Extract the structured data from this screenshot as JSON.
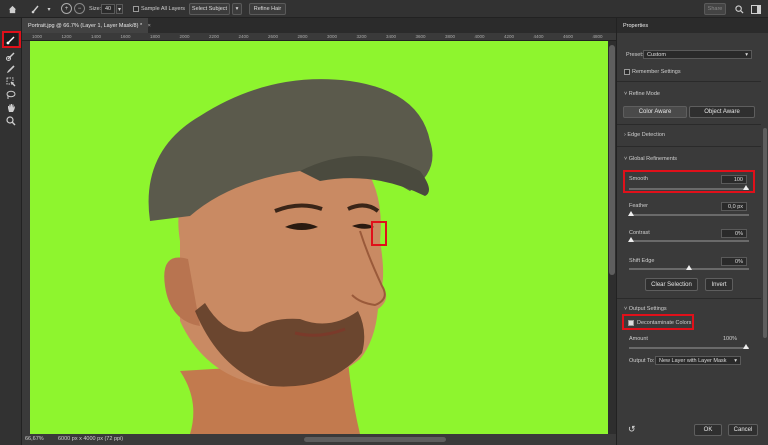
{
  "options_bar": {
    "size_label": "Size:",
    "size_value": "40",
    "sample_all_layers": "Sample All Layers",
    "select_subject": "Select Subject",
    "refine_hair": "Refine Hair",
    "share": "Share"
  },
  "document": {
    "tab_title": "Portrait.jpg @ 66.7% (Layer 1, Layer Mask/8) *",
    "ruler_ticks": [
      "1000",
      "1200",
      "1400",
      "1600",
      "1800",
      "2000",
      "2200",
      "2400",
      "2600",
      "2800",
      "3000",
      "3200",
      "3400",
      "3600",
      "3800",
      "4000",
      "4200",
      "4400",
      "4600",
      "4800"
    ],
    "zoom": "66,67%",
    "doc_info": "6000 px x 4000 px (72 ppi)"
  },
  "properties": {
    "title": "Properties",
    "preset_label": "Preset:",
    "preset_value": "Custom",
    "remember_settings": "Remember Settings",
    "refine_mode_header": "Refine Mode",
    "color_aware": "Color Aware",
    "object_aware": "Object Aware",
    "edge_detection_header": "Edge Detection",
    "global_refinements_header": "Global Refinements",
    "smooth_label": "Smooth",
    "smooth_value": "100",
    "feather_label": "Feather",
    "feather_value": "0,0 px",
    "contrast_label": "Contrast",
    "contrast_value": "0%",
    "shift_edge_label": "Shift Edge",
    "shift_edge_value": "0%",
    "clear_selection": "Clear Selection",
    "invert": "Invert",
    "output_settings_header": "Output Settings",
    "decontaminate_colors": "Decontaminate Colors",
    "amount_label": "Amount",
    "amount_value": "100%",
    "output_to_label": "Output To:",
    "output_to_value": "New Layer with Layer Mask",
    "ok": "OK",
    "cancel": "Cancel"
  },
  "colors": {
    "canvas_bg": "#8ef52e",
    "highlight": "#e0101a",
    "panel_bg": "#3a3a3a"
  }
}
